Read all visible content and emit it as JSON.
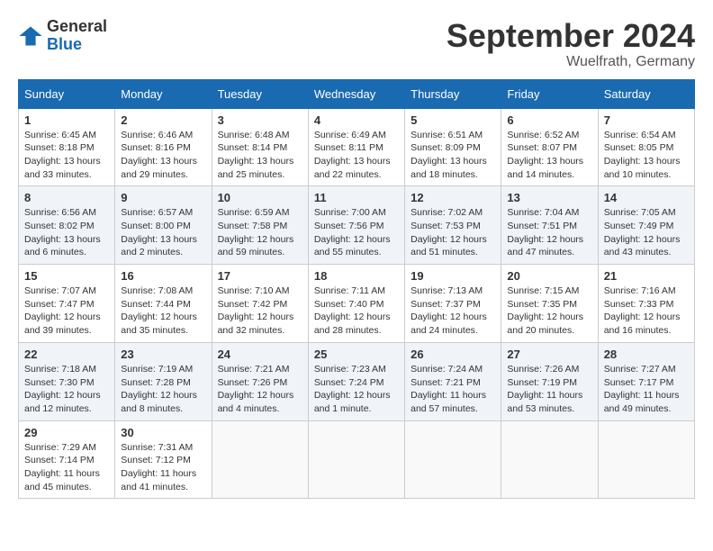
{
  "header": {
    "logo_general": "General",
    "logo_blue": "Blue",
    "month_title": "September 2024",
    "location": "Wuelfrath, Germany"
  },
  "weekdays": [
    "Sunday",
    "Monday",
    "Tuesday",
    "Wednesday",
    "Thursday",
    "Friday",
    "Saturday"
  ],
  "weeks": [
    [
      {
        "day": "1",
        "sunrise": "6:45 AM",
        "sunset": "8:18 PM",
        "daylight": "13 hours and 33 minutes."
      },
      {
        "day": "2",
        "sunrise": "6:46 AM",
        "sunset": "8:16 PM",
        "daylight": "13 hours and 29 minutes."
      },
      {
        "day": "3",
        "sunrise": "6:48 AM",
        "sunset": "8:14 PM",
        "daylight": "13 hours and 25 minutes."
      },
      {
        "day": "4",
        "sunrise": "6:49 AM",
        "sunset": "8:11 PM",
        "daylight": "13 hours and 22 minutes."
      },
      {
        "day": "5",
        "sunrise": "6:51 AM",
        "sunset": "8:09 PM",
        "daylight": "13 hours and 18 minutes."
      },
      {
        "day": "6",
        "sunrise": "6:52 AM",
        "sunset": "8:07 PM",
        "daylight": "13 hours and 14 minutes."
      },
      {
        "day": "7",
        "sunrise": "6:54 AM",
        "sunset": "8:05 PM",
        "daylight": "13 hours and 10 minutes."
      }
    ],
    [
      {
        "day": "8",
        "sunrise": "6:56 AM",
        "sunset": "8:02 PM",
        "daylight": "13 hours and 6 minutes."
      },
      {
        "day": "9",
        "sunrise": "6:57 AM",
        "sunset": "8:00 PM",
        "daylight": "13 hours and 2 minutes."
      },
      {
        "day": "10",
        "sunrise": "6:59 AM",
        "sunset": "7:58 PM",
        "daylight": "12 hours and 59 minutes."
      },
      {
        "day": "11",
        "sunrise": "7:00 AM",
        "sunset": "7:56 PM",
        "daylight": "12 hours and 55 minutes."
      },
      {
        "day": "12",
        "sunrise": "7:02 AM",
        "sunset": "7:53 PM",
        "daylight": "12 hours and 51 minutes."
      },
      {
        "day": "13",
        "sunrise": "7:04 AM",
        "sunset": "7:51 PM",
        "daylight": "12 hours and 47 minutes."
      },
      {
        "day": "14",
        "sunrise": "7:05 AM",
        "sunset": "7:49 PM",
        "daylight": "12 hours and 43 minutes."
      }
    ],
    [
      {
        "day": "15",
        "sunrise": "7:07 AM",
        "sunset": "7:47 PM",
        "daylight": "12 hours and 39 minutes."
      },
      {
        "day": "16",
        "sunrise": "7:08 AM",
        "sunset": "7:44 PM",
        "daylight": "12 hours and 35 minutes."
      },
      {
        "day": "17",
        "sunrise": "7:10 AM",
        "sunset": "7:42 PM",
        "daylight": "12 hours and 32 minutes."
      },
      {
        "day": "18",
        "sunrise": "7:11 AM",
        "sunset": "7:40 PM",
        "daylight": "12 hours and 28 minutes."
      },
      {
        "day": "19",
        "sunrise": "7:13 AM",
        "sunset": "7:37 PM",
        "daylight": "12 hours and 24 minutes."
      },
      {
        "day": "20",
        "sunrise": "7:15 AM",
        "sunset": "7:35 PM",
        "daylight": "12 hours and 20 minutes."
      },
      {
        "day": "21",
        "sunrise": "7:16 AM",
        "sunset": "7:33 PM",
        "daylight": "12 hours and 16 minutes."
      }
    ],
    [
      {
        "day": "22",
        "sunrise": "7:18 AM",
        "sunset": "7:30 PM",
        "daylight": "12 hours and 12 minutes."
      },
      {
        "day": "23",
        "sunrise": "7:19 AM",
        "sunset": "7:28 PM",
        "daylight": "12 hours and 8 minutes."
      },
      {
        "day": "24",
        "sunrise": "7:21 AM",
        "sunset": "7:26 PM",
        "daylight": "12 hours and 4 minutes."
      },
      {
        "day": "25",
        "sunrise": "7:23 AM",
        "sunset": "7:24 PM",
        "daylight": "12 hours and 1 minute."
      },
      {
        "day": "26",
        "sunrise": "7:24 AM",
        "sunset": "7:21 PM",
        "daylight": "11 hours and 57 minutes."
      },
      {
        "day": "27",
        "sunrise": "7:26 AM",
        "sunset": "7:19 PM",
        "daylight": "11 hours and 53 minutes."
      },
      {
        "day": "28",
        "sunrise": "7:27 AM",
        "sunset": "7:17 PM",
        "daylight": "11 hours and 49 minutes."
      }
    ],
    [
      {
        "day": "29",
        "sunrise": "7:29 AM",
        "sunset": "7:14 PM",
        "daylight": "11 hours and 45 minutes."
      },
      {
        "day": "30",
        "sunrise": "7:31 AM",
        "sunset": "7:12 PM",
        "daylight": "11 hours and 41 minutes."
      },
      null,
      null,
      null,
      null,
      null
    ]
  ]
}
